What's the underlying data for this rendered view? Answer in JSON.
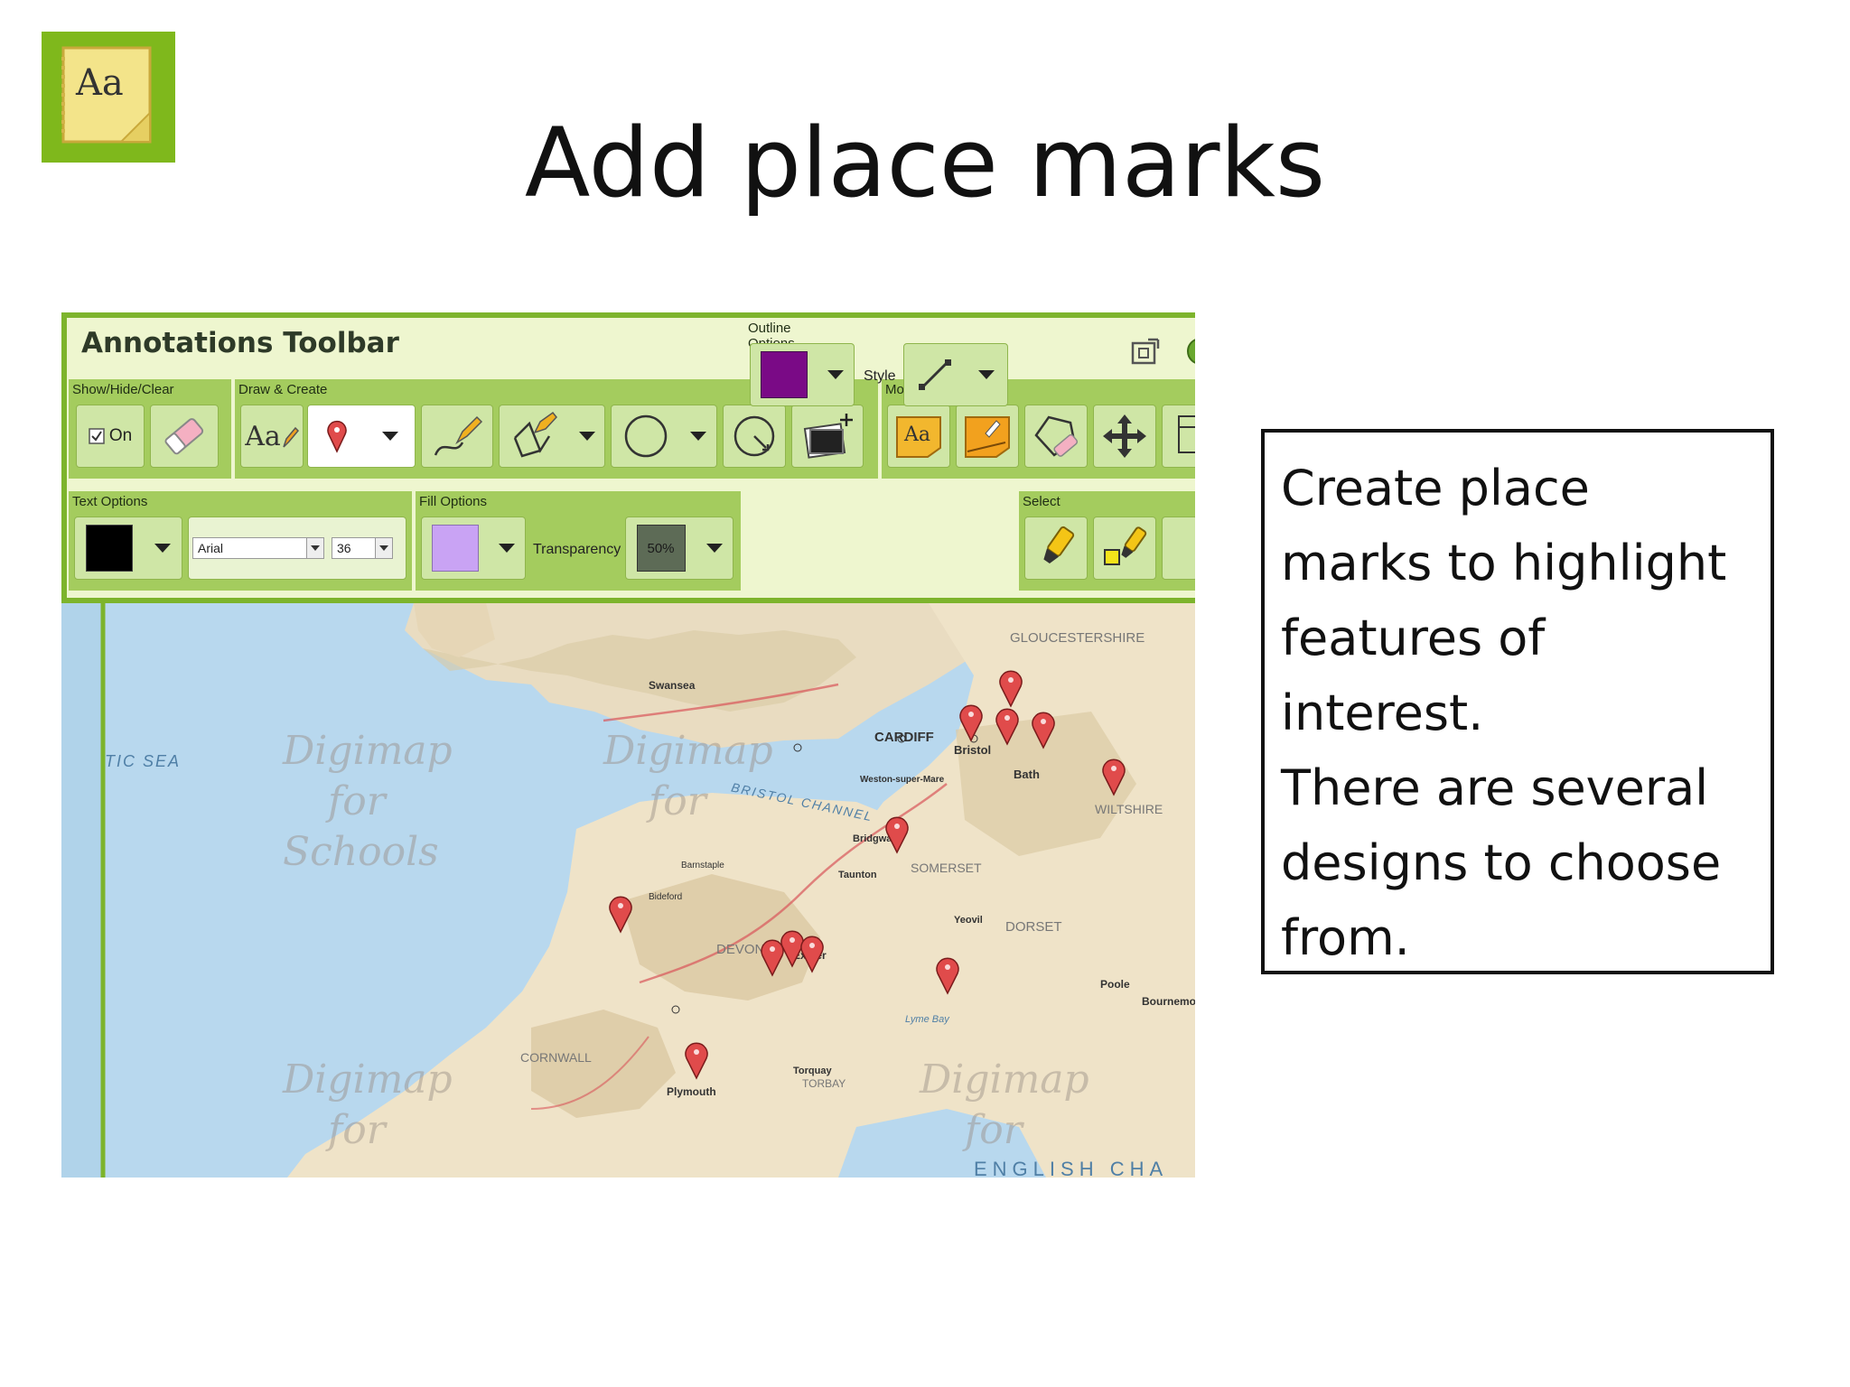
{
  "slide": {
    "title": "Add place marks",
    "logo_text": "Aa",
    "description_lines": [
      "Create place",
      "marks to highlight",
      "features of",
      "interest.",
      "There are several",
      "designs to choose",
      "from."
    ]
  },
  "toolbar": {
    "title": "Annotations Toolbar",
    "groups": {
      "show_hide_clear": "Show/Hide/Clear",
      "draw_create": "Draw & Create",
      "modify": "Modify",
      "text_options": "Text Options",
      "fill_options": "Fill Options",
      "outline_options": "Outline Options",
      "select": "Select"
    },
    "on_label": "On",
    "text_tool_label": "Aa",
    "modify_text_label": "Aa",
    "font_name": "Arial",
    "font_size": "36",
    "transparency_label": "Transparency",
    "transparency_value": "50%",
    "style_label": "Style",
    "colors": {
      "text": "#000000",
      "fill": "#c9a3f4",
      "outline": "#7a0a86",
      "transparency": "#5d6b56",
      "accent": "#7db42c"
    }
  },
  "map": {
    "labels": {
      "sea": "TIC SEA",
      "channel": "BRISTOL CHANNEL",
      "cardiff": "CARDIFF",
      "bristol": "Bristol",
      "bath": "Bath",
      "swansea": "Swansea",
      "gloucestershire": "GLOUCESTERSHIRE",
      "wiltshire": "WILTSHIRE",
      "somerset": "SOMERSET",
      "devon": "DEVON",
      "dorset": "DORSET",
      "cornwall": "CORNWALL",
      "exeter": "Exeter",
      "plymouth": "Plymouth",
      "taunton": "Taunton",
      "bridgwater": "Bridgwater",
      "torbay": "TORBAY",
      "torquay": "Torquay",
      "poole": "Poole",
      "bournemouth": "Bournemo",
      "weston": "Weston-super-Mare",
      "barnstaple": "Barnstaple",
      "bideford": "Bideford",
      "yeovil": "Yeovil",
      "lyme_bay": "Lyme Bay",
      "english_channel": "ENGLISH CHA"
    },
    "watermark": [
      "Digimap",
      "for",
      "Schools"
    ],
    "pin_color": "#e04b4b"
  }
}
